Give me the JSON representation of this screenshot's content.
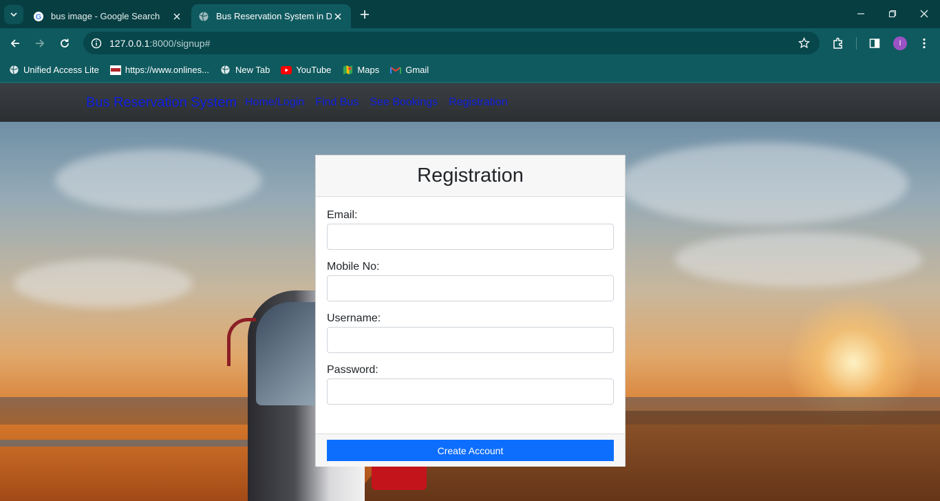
{
  "browser": {
    "tabs": [
      {
        "title": "bus image - Google Search",
        "active": false,
        "favicon": "google-icon"
      },
      {
        "title": "Bus Reservation System in Djang",
        "active": true,
        "favicon": "globe-icon"
      }
    ],
    "url_host": "127.0.0.1",
    "url_path": ":8000/signup#",
    "profile_initial": "I",
    "bookmarks": [
      {
        "label": "Unified Access Lite",
        "icon": "globe-icon"
      },
      {
        "label": "https://www.onlines...",
        "icon": "nsdl-icon"
      },
      {
        "label": "New Tab",
        "icon": "globe-icon"
      },
      {
        "label": "YouTube",
        "icon": "youtube-icon"
      },
      {
        "label": "Maps",
        "icon": "maps-icon"
      },
      {
        "label": "Gmail",
        "icon": "gmail-icon"
      }
    ]
  },
  "navbar": {
    "brand": "Bus Reservation System",
    "links": [
      "Home/Login",
      "Find Bus",
      "See Bookings",
      "Registration"
    ]
  },
  "form": {
    "title": "Registration",
    "fields": [
      {
        "label": "Email:",
        "value": ""
      },
      {
        "label": "Mobile No:",
        "value": ""
      },
      {
        "label": "Username:",
        "value": ""
      },
      {
        "label": "Password:",
        "value": ""
      }
    ],
    "submit_label": "Create Account"
  },
  "colors": {
    "brand_link": "#0d1de0",
    "primary_button": "#0d6efd",
    "chrome_bg": "#0f5a5f"
  }
}
